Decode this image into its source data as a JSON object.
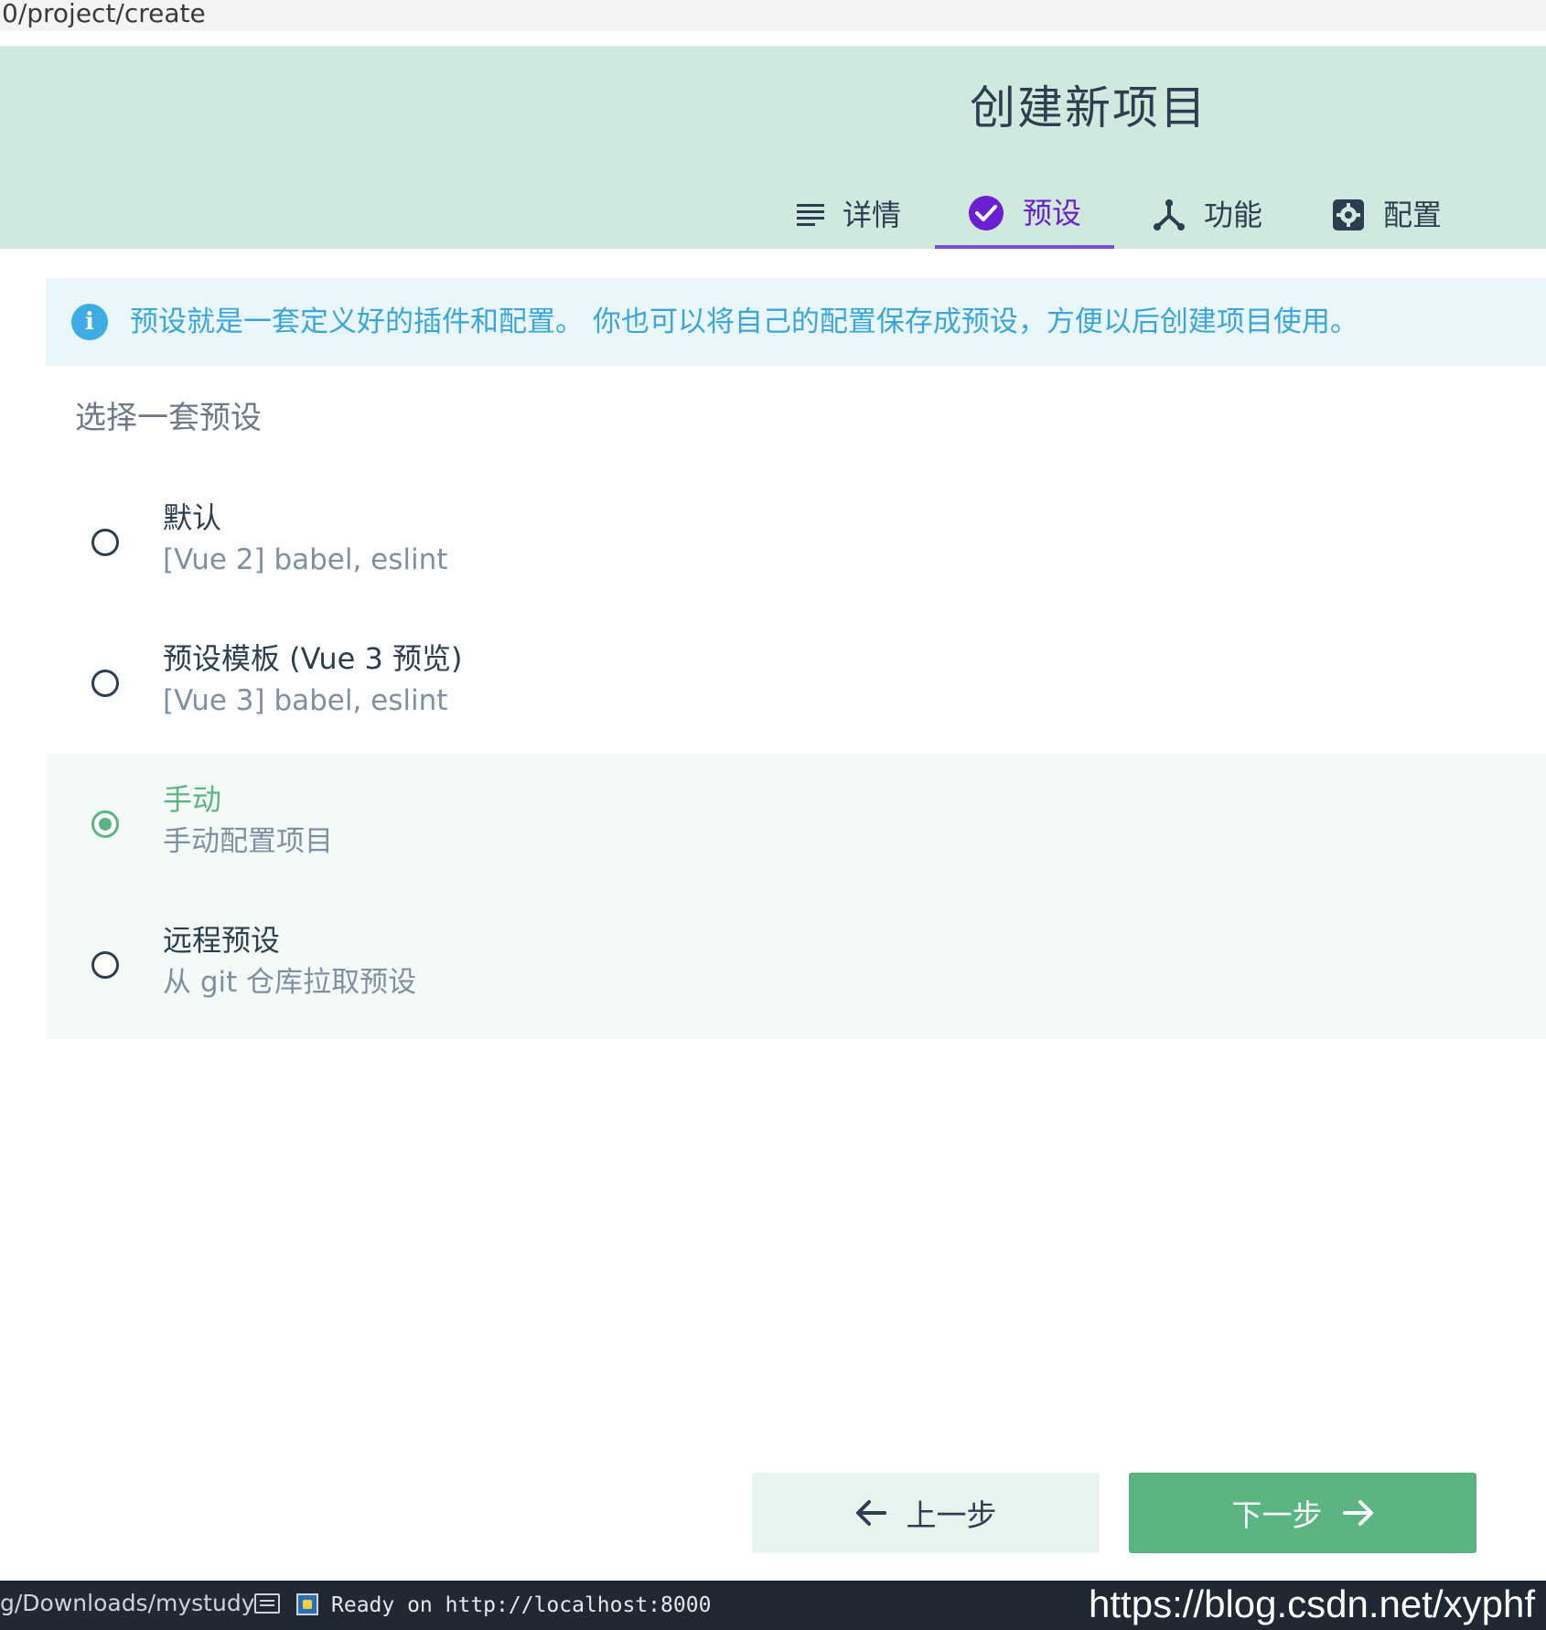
{
  "browser": {
    "url_fragment": "0/project/create"
  },
  "header": {
    "title": "创建新项目",
    "tabs": [
      {
        "label": "详情",
        "icon": "list-icon",
        "active": false
      },
      {
        "label": "预设",
        "icon": "check-circle-icon",
        "active": true
      },
      {
        "label": "功能",
        "icon": "fork-icon",
        "active": false
      },
      {
        "label": "配置",
        "icon": "gear-icon",
        "active": false
      }
    ]
  },
  "info": {
    "icon": "info-icon",
    "text": "预设就是一套定义好的插件和配置。 你也可以将自己的配置保存成预设，方便以后创建项目使用。"
  },
  "section_title": "选择一套预设",
  "options": [
    {
      "name": "默认",
      "desc": "[Vue 2] babel, eslint",
      "selected": false
    },
    {
      "name": "预设模板 (Vue 3 预览)",
      "desc": "[Vue 3] babel, eslint",
      "selected": false
    },
    {
      "name": "手动",
      "desc": "手动配置项目",
      "selected": true
    },
    {
      "name": "远程预设",
      "desc": "从 git 仓库拉取预设",
      "selected": false
    }
  ],
  "buttons": {
    "prev": "上一步",
    "next": "下一步"
  },
  "statusbar": {
    "path": "g/Downloads/mystudy",
    "ready": "Ready on http://localhost:8000",
    "watermark": "https://blog.csdn.net/xyphf"
  },
  "colors": {
    "accent_green": "#5ab583",
    "header_bg": "#cfe9de",
    "active_tab": "#6a1fd0",
    "info_blue": "#3ba6dd"
  }
}
